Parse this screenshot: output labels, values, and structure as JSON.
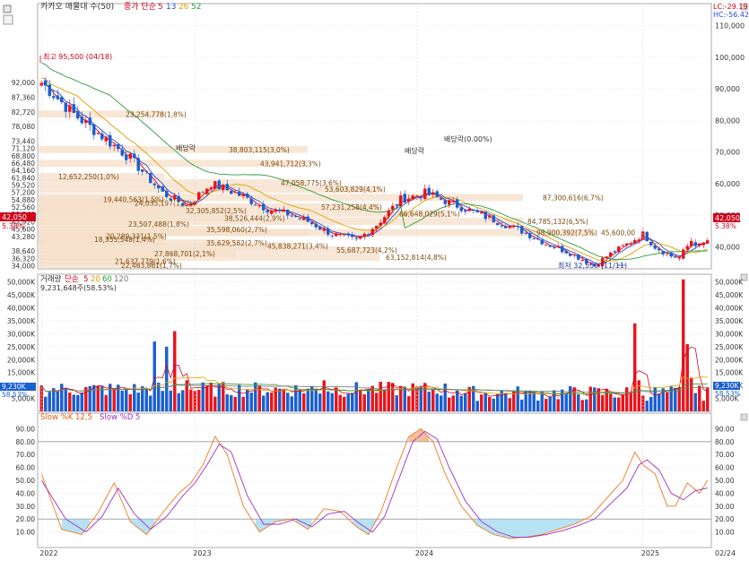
{
  "header": {
    "title": "카카오 매물대 수(50)",
    "ma_label": "종가 단순",
    "ma_periods": [
      "5",
      "13",
      "26",
      "52"
    ],
    "ma_colors": [
      "#d0021b",
      "#2a4fd6",
      "#e0a000",
      "#2e9b3a"
    ],
    "lc": "LC:-29.19",
    "hc": "HC:-56.42"
  },
  "volume_header": {
    "title": "거래량",
    "ma_label": "단순",
    "ma_periods": [
      "5",
      "20",
      "60",
      "120"
    ],
    "ma_colors": [
      "#d0021b",
      "#e0a000",
      "#2e9b3a",
      "#777777"
    ],
    "current": "9,231,648주(58.53%)"
  },
  "stoch_header": {
    "k_label": "Slow %K 12,5",
    "d_label": "Slow %D 5"
  },
  "annotations": {
    "high": "최고 95,500 (04/18)",
    "low": "최저 32,550 (11/11)",
    "div1": "배당락",
    "div2": "배당락",
    "div3": "배당락(0.00%)"
  },
  "price_badges": {
    "last": "42,050",
    "last_pct": "5.38%",
    "last_small": "42,050",
    "vol_last": "9,230K",
    "vol_pct": "58.53%"
  },
  "chart_data": {
    "type": "candlestick",
    "price_axis": {
      "right_ticks": [
        "110,000",
        "100,000",
        "90,000",
        "80,000",
        "70,000",
        "60,000",
        "50,000",
        "40,000"
      ],
      "right_values": [
        110000,
        100000,
        90000,
        80000,
        70000,
        60000,
        50000,
        40000
      ],
      "left_ticks": [
        "92,000",
        "87,360",
        "82,720",
        "78,080",
        "73,440",
        "71,120",
        "68,800",
        "66,480",
        "64,160",
        "61,840",
        "59,520",
        "57,200",
        "54,880",
        "52,560",
        "50,240",
        "47,920",
        "45,600",
        "43,280",
        "38,640",
        "36,320",
        "34,000"
      ],
      "left_values": [
        92000,
        87360,
        82720,
        78080,
        73440,
        71120,
        68800,
        66480,
        64160,
        61840,
        59520,
        57200,
        54880,
        52560,
        50240,
        47920,
        45600,
        43280,
        38640,
        36320,
        34000
      ],
      "ylim": [
        33000,
        117000
      ]
    },
    "volume_axis": {
      "ticks": [
        "50,000K",
        "45,000K",
        "40,000K",
        "35,000K",
        "30,000K",
        "25,000K",
        "20,000K",
        "15,000K",
        "10,000K",
        "5,000K"
      ],
      "values": [
        50000,
        45000,
        40000,
        35000,
        30000,
        25000,
        20000,
        15000,
        10000,
        5000
      ],
      "ylim": [
        0,
        53000
      ]
    },
    "stoch_axis": {
      "ticks": [
        "90.00",
        "80.00",
        "70.00",
        "60.00",
        "50.00",
        "40.00",
        "30.00",
        "20.00",
        "10.00"
      ],
      "values": [
        90,
        80,
        70,
        60,
        50,
        40,
        30,
        20,
        10
      ],
      "ylim": [
        0,
        100
      ]
    },
    "x_labels": [
      "2022",
      "2023",
      "2024",
      "2025",
      "02/24"
    ],
    "x_label_index": [
      0,
      38,
      93,
      149,
      165
    ],
    "bar_count": 166,
    "close_anchors": [
      [
        0,
        92000
      ],
      [
        8,
        82000
      ],
      [
        16,
        74000
      ],
      [
        22,
        68000
      ],
      [
        30,
        57000
      ],
      [
        36,
        53000
      ],
      [
        42,
        60000
      ],
      [
        48,
        57000
      ],
      [
        56,
        52000
      ],
      [
        62,
        50000
      ],
      [
        66,
        48000
      ],
      [
        72,
        44000
      ],
      [
        78,
        42000
      ],
      [
        83,
        47000
      ],
      [
        89,
        55000
      ],
      [
        95,
        57000
      ],
      [
        101,
        54000
      ],
      [
        107,
        51000
      ],
      [
        113,
        48000
      ],
      [
        119,
        45000
      ],
      [
        125,
        41000
      ],
      [
        131,
        38000
      ],
      [
        137,
        34000
      ],
      [
        140,
        37000
      ],
      [
        144,
        40000
      ],
      [
        149,
        44000
      ],
      [
        152,
        40000
      ],
      [
        156,
        37000
      ],
      [
        158,
        36500
      ],
      [
        161,
        42000
      ],
      [
        163,
        40000
      ],
      [
        165,
        42050
      ]
    ],
    "volume_spikes": [
      [
        28,
        27000
      ],
      [
        31,
        25000
      ],
      [
        33,
        31000
      ],
      [
        36,
        12000
      ],
      [
        70,
        12000
      ],
      [
        103,
        8000
      ],
      [
        121,
        8000
      ],
      [
        147,
        34000
      ],
      [
        148,
        12000
      ],
      [
        159,
        51000
      ],
      [
        160,
        26000
      ],
      [
        161,
        13000
      ]
    ],
    "volume_profile": [
      {
        "label": "23,254,778(1,8%)",
        "price": 82000
      },
      {
        "label": "38,803,115(3,0%)",
        "price": 70800
      },
      {
        "label": "43,941,712(3,3%)",
        "price": 66400
      },
      {
        "label": "12,652,250(1,0%)",
        "price": 62200
      },
      {
        "label": "47,058,775(3,6%)",
        "price": 60200
      },
      {
        "label": "53,603,829(4,1%)",
        "price": 58200
      },
      {
        "label": "19,440,563(1,5%)",
        "price": 55000
      },
      {
        "label": "24,035,197(1,9%)",
        "price": 53800
      },
      {
        "label": "32,305,852(2,5%)",
        "price": 51500
      },
      {
        "label": "57,231,258(4,4%)",
        "price": 52600
      },
      {
        "label": "87,300,616(6,7%)",
        "price": 55600
      },
      {
        "label": "38,526,444(2,9%)",
        "price": 49100
      },
      {
        "label": "66,648,029(5,1%)",
        "price": 50500
      },
      {
        "label": "23,507,488(1,8%)",
        "price": 47200
      },
      {
        "label": "84,785,132(6,5%)",
        "price": 48000
      },
      {
        "label": "35,598,060(2,7%)",
        "price": 45500
      },
      {
        "label": "98,900,392(7,5%)",
        "price": 44500
      },
      {
        "label": "45,600,00",
        "price": 44500
      },
      {
        "label": "20,289,331(1,5%)",
        "price": 43300
      },
      {
        "label": "18,355,548(1,4%)",
        "price": 42300
      },
      {
        "label": "35,629,582(2,7%)",
        "price": 41300
      },
      {
        "label": "45,838,271(3,4%)",
        "price": 40200
      },
      {
        "label": "55,687,723(4,2%)",
        "price": 39000
      },
      {
        "label": "27,868,701(2,1%)",
        "price": 37800
      },
      {
        "label": "63,152,814(4,8%)",
        "price": 36700
      },
      {
        "label": "21,637,779(1,6%)",
        "price": 35400
      },
      {
        "label": "22,463,861(1,7%)",
        "price": 34200
      }
    ],
    "stoch_k_anchors": [
      [
        0,
        55
      ],
      [
        5,
        12
      ],
      [
        10,
        8
      ],
      [
        14,
        25
      ],
      [
        18,
        48
      ],
      [
        22,
        18
      ],
      [
        26,
        8
      ],
      [
        30,
        25
      ],
      [
        34,
        40
      ],
      [
        37,
        48
      ],
      [
        40,
        62
      ],
      [
        43,
        84
      ],
      [
        46,
        70
      ],
      [
        50,
        30
      ],
      [
        54,
        10
      ],
      [
        58,
        18
      ],
      [
        62,
        20
      ],
      [
        66,
        12
      ],
      [
        70,
        28
      ],
      [
        74,
        26
      ],
      [
        78,
        14
      ],
      [
        81,
        8
      ],
      [
        84,
        25
      ],
      [
        88,
        60
      ],
      [
        91,
        84
      ],
      [
        94,
        90
      ],
      [
        97,
        80
      ],
      [
        100,
        55
      ],
      [
        104,
        30
      ],
      [
        108,
        15
      ],
      [
        112,
        8
      ],
      [
        116,
        5
      ],
      [
        120,
        6
      ],
      [
        124,
        8
      ],
      [
        128,
        12
      ],
      [
        132,
        16
      ],
      [
        136,
        22
      ],
      [
        140,
        36
      ],
      [
        144,
        50
      ],
      [
        147,
        72
      ],
      [
        149,
        62
      ],
      [
        152,
        55
      ],
      [
        155,
        30
      ],
      [
        157,
        30
      ],
      [
        160,
        48
      ],
      [
        163,
        40
      ],
      [
        165,
        50
      ]
    ],
    "stoch_d_anchors": [
      [
        0,
        50
      ],
      [
        6,
        20
      ],
      [
        11,
        10
      ],
      [
        15,
        22
      ],
      [
        19,
        44
      ],
      [
        23,
        24
      ],
      [
        27,
        12
      ],
      [
        31,
        22
      ],
      [
        35,
        38
      ],
      [
        38,
        48
      ],
      [
        41,
        62
      ],
      [
        44,
        78
      ],
      [
        47,
        72
      ],
      [
        51,
        38
      ],
      [
        55,
        16
      ],
      [
        59,
        16
      ],
      [
        63,
        20
      ],
      [
        67,
        14
      ],
      [
        71,
        24
      ],
      [
        75,
        26
      ],
      [
        79,
        16
      ],
      [
        82,
        10
      ],
      [
        85,
        22
      ],
      [
        89,
        55
      ],
      [
        92,
        80
      ],
      [
        95,
        88
      ],
      [
        98,
        82
      ],
      [
        101,
        60
      ],
      [
        105,
        34
      ],
      [
        109,
        18
      ],
      [
        113,
        10
      ],
      [
        117,
        6
      ],
      [
        121,
        6
      ],
      [
        125,
        8
      ],
      [
        129,
        11
      ],
      [
        133,
        15
      ],
      [
        137,
        20
      ],
      [
        141,
        32
      ],
      [
        145,
        44
      ],
      [
        148,
        62
      ],
      [
        150,
        66
      ],
      [
        153,
        58
      ],
      [
        156,
        40
      ],
      [
        159,
        35
      ],
      [
        162,
        42
      ],
      [
        165,
        44
      ]
    ]
  }
}
